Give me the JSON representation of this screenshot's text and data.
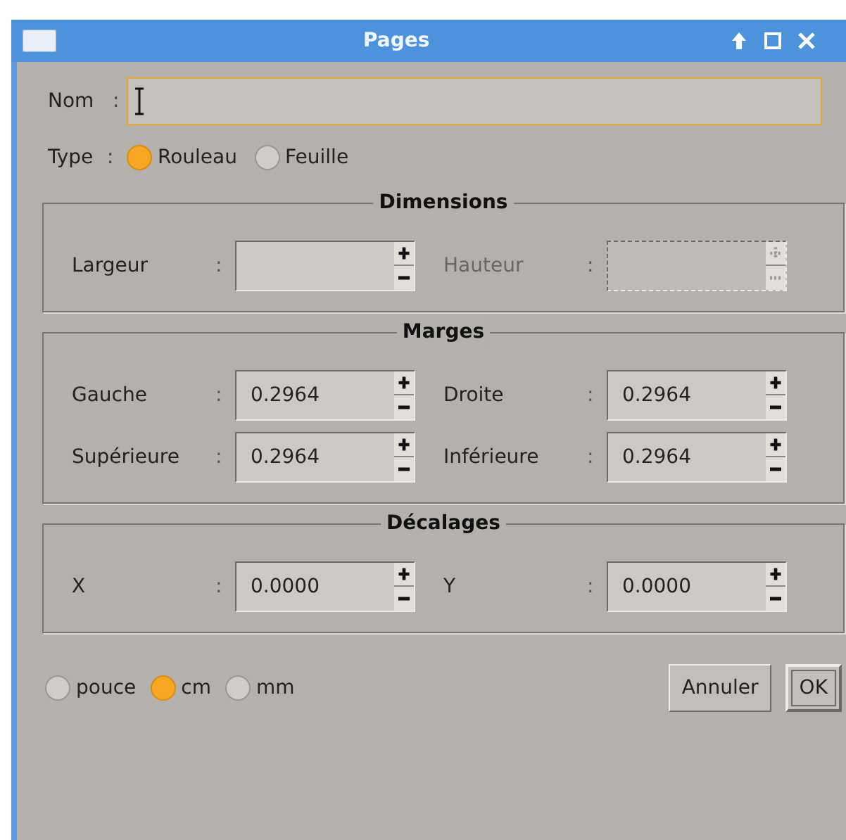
{
  "window": {
    "title": "Pages"
  },
  "name_field": {
    "label": "Nom",
    "separator": ":",
    "focused": true
  },
  "type": {
    "label": "Type",
    "separator": ":",
    "options": [
      {
        "label": "Rouleau",
        "selected": true
      },
      {
        "label": "Feuille",
        "selected": false
      }
    ]
  },
  "groups": [
    {
      "title": "Dimensions",
      "fields": [
        {
          "label": "Largeur",
          "separator": ":",
          "disabled": false
        },
        {
          "label": "Hauteur",
          "separator": ":",
          "disabled": true
        }
      ]
    },
    {
      "title": "Marges",
      "fields": [
        {
          "label": "Gauche",
          "separator": ":",
          "value": "0.2964",
          "disabled": false
        },
        {
          "label": "Droite",
          "separator": ":",
          "value": "0.2964",
          "disabled": false
        },
        {
          "label": "Supérieure",
          "separator": ":",
          "value": "0.2964",
          "disabled": false
        },
        {
          "label": "Inférieure",
          "separator": ":",
          "value": "0.2964",
          "disabled": false
        }
      ]
    },
    {
      "title": "Décalages",
      "fields": [
        {
          "label": "X",
          "separator": ":",
          "value": "0.0000",
          "disabled": false
        },
        {
          "label": "Y",
          "separator": ":",
          "value": "0.0000",
          "disabled": false
        }
      ]
    }
  ],
  "units": [
    {
      "label": "pouce",
      "selected": false
    },
    {
      "label": "cm",
      "selected": true
    },
    {
      "label": "mm",
      "selected": false
    }
  ],
  "buttons": [
    {
      "label": "Annuler",
      "default": false
    },
    {
      "label": "OK",
      "default": true
    }
  ]
}
